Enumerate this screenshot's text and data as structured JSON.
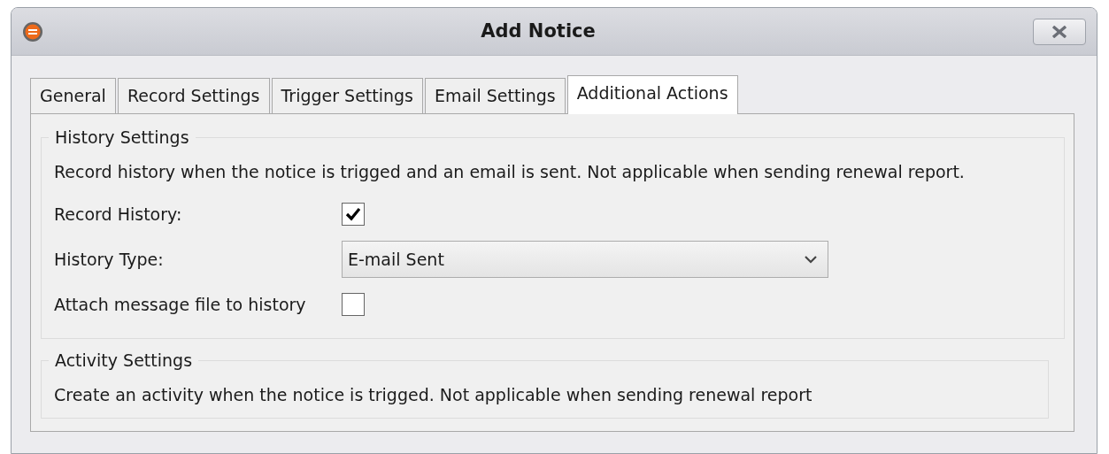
{
  "window": {
    "title": "Add Notice"
  },
  "tabs": [
    {
      "label": "General",
      "selected": false
    },
    {
      "label": "Record Settings",
      "selected": false
    },
    {
      "label": "Trigger Settings",
      "selected": false
    },
    {
      "label": "Email Settings",
      "selected": false
    },
    {
      "label": "Additional Actions",
      "selected": true
    }
  ],
  "history_settings": {
    "title": "History Settings",
    "description": "Record history when the notice is trigged and an email is sent. Not applicable when sending renewal report.",
    "fields": [
      {
        "kind": "checkbox",
        "label": "Record History:",
        "checked": true
      },
      {
        "kind": "select",
        "label": "History Type:",
        "value": "E-mail Sent"
      },
      {
        "kind": "checkbox",
        "label": "Attach message file to history",
        "checked": false
      }
    ]
  },
  "activity_settings": {
    "title": "Activity Settings",
    "description": "Create an activity when the notice is trigged. Not applicable when sending renewal report"
  }
}
